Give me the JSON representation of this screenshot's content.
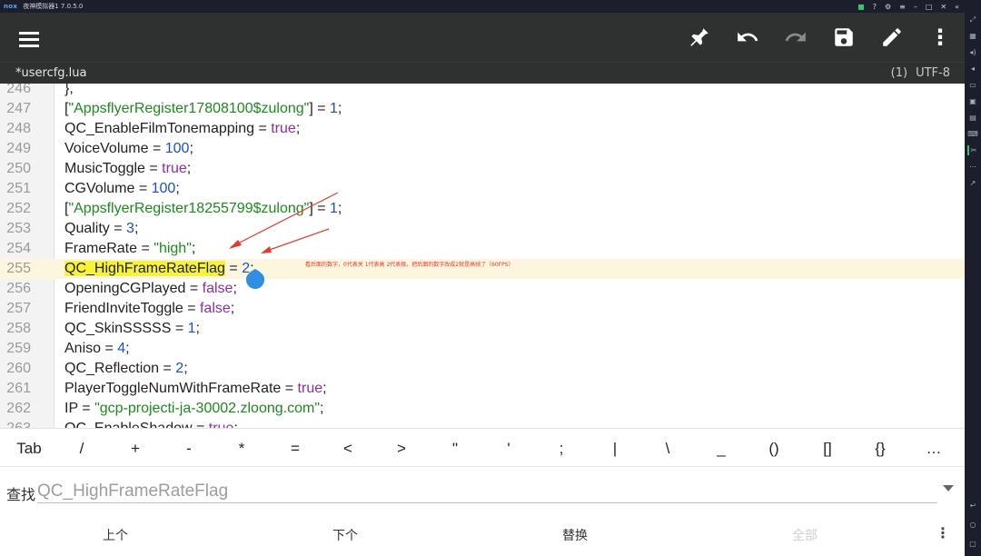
{
  "emulator": {
    "logo": "nox",
    "title": "夜神模拟器1 7.0.5.0"
  },
  "toolbar": {
    "menu": "menu-icon",
    "pin": "pin-icon",
    "undo": "undo-icon",
    "redo": "redo-icon",
    "save": "save-icon",
    "edit": "edit-icon",
    "more": "more-vert-icon"
  },
  "file": {
    "name": "*usercfg.lua",
    "count": "(1)",
    "encoding": "UTF-8"
  },
  "lines": [
    {
      "num": "246",
      "tokens": [
        {
          "t": "},",
          "c": ""
        }
      ]
    },
    {
      "num": "247",
      "tokens": [
        {
          "t": "[",
          "c": ""
        },
        {
          "t": "\"AppsflyerRegister17808100$zulong\"",
          "c": "str"
        },
        {
          "t": "] = ",
          "c": ""
        },
        {
          "t": "1",
          "c": "num"
        },
        {
          "t": ";",
          "c": ""
        }
      ]
    },
    {
      "num": "248",
      "tokens": [
        {
          "t": "QC_EnableFilmTonemapping = ",
          "c": ""
        },
        {
          "t": "true",
          "c": "kw"
        },
        {
          "t": ";",
          "c": ""
        }
      ]
    },
    {
      "num": "249",
      "tokens": [
        {
          "t": "VoiceVolume = ",
          "c": ""
        },
        {
          "t": "100",
          "c": "num"
        },
        {
          "t": ";",
          "c": ""
        }
      ]
    },
    {
      "num": "250",
      "tokens": [
        {
          "t": "MusicToggle = ",
          "c": ""
        },
        {
          "t": "true",
          "c": "kw"
        },
        {
          "t": ";",
          "c": ""
        }
      ]
    },
    {
      "num": "251",
      "tokens": [
        {
          "t": "CGVolume = ",
          "c": ""
        },
        {
          "t": "100",
          "c": "num"
        },
        {
          "t": ";",
          "c": ""
        }
      ]
    },
    {
      "num": "252",
      "tokens": [
        {
          "t": "[",
          "c": ""
        },
        {
          "t": "\"AppsflyerRegister18255799$zulong\"",
          "c": "str"
        },
        {
          "t": "] = ",
          "c": ""
        },
        {
          "t": "1",
          "c": "num"
        },
        {
          "t": ";",
          "c": ""
        }
      ]
    },
    {
      "num": "253",
      "tokens": [
        {
          "t": "Quality = ",
          "c": ""
        },
        {
          "t": "3",
          "c": "num"
        },
        {
          "t": ";",
          "c": ""
        }
      ]
    },
    {
      "num": "254",
      "tokens": [
        {
          "t": "FrameRate = ",
          "c": ""
        },
        {
          "t": "\"high\"",
          "c": "str"
        },
        {
          "t": ";",
          "c": ""
        }
      ]
    },
    {
      "num": "255",
      "highlight": true,
      "tokens": [
        {
          "t": "QC_HighFrameRateFlag",
          "c": "match"
        },
        {
          "t": " = ",
          "c": ""
        },
        {
          "t": "2",
          "c": "num"
        },
        {
          "t": ";",
          "c": ""
        }
      ]
    },
    {
      "num": "256",
      "tokens": [
        {
          "t": "OpeningCGPlayed = ",
          "c": ""
        },
        {
          "t": "false",
          "c": "kw"
        },
        {
          "t": ";",
          "c": ""
        }
      ]
    },
    {
      "num": "257",
      "tokens": [
        {
          "t": "FriendInviteToggle = ",
          "c": ""
        },
        {
          "t": "false",
          "c": "kw"
        },
        {
          "t": ";",
          "c": ""
        }
      ]
    },
    {
      "num": "258",
      "tokens": [
        {
          "t": "QC_SkinSSSSS = ",
          "c": ""
        },
        {
          "t": "1",
          "c": "num"
        },
        {
          "t": ";",
          "c": ""
        }
      ]
    },
    {
      "num": "259",
      "tokens": [
        {
          "t": "Aniso = ",
          "c": ""
        },
        {
          "t": "4",
          "c": "num"
        },
        {
          "t": ";",
          "c": ""
        }
      ]
    },
    {
      "num": "260",
      "tokens": [
        {
          "t": "QC_Reflection = ",
          "c": ""
        },
        {
          "t": "2",
          "c": "num"
        },
        {
          "t": ";",
          "c": ""
        }
      ]
    },
    {
      "num": "261",
      "tokens": [
        {
          "t": "PlayerToggleNumWithFrameRate = ",
          "c": ""
        },
        {
          "t": "true",
          "c": "kw"
        },
        {
          "t": ";",
          "c": ""
        }
      ]
    },
    {
      "num": "262",
      "tokens": [
        {
          "t": "IP = ",
          "c": ""
        },
        {
          "t": "\"gcp-projecti-ja-30002.zloong.com\"",
          "c": "str"
        },
        {
          "t": ";",
          "c": ""
        }
      ]
    },
    {
      "num": "263",
      "tokens": [
        {
          "t": "QC_EnableShadow = ",
          "c": ""
        },
        {
          "t": "true",
          "c": "kw"
        },
        {
          "t": ";",
          "c": ""
        }
      ]
    }
  ],
  "annotation": "看后面的数字，0代表关 1代表高 2代表极，把后面的数字改成2就是高帧了（60FPS）",
  "symbols": [
    "Tab",
    "/",
    "+",
    "-",
    "*",
    "=",
    "<",
    ">",
    "\"",
    "'",
    ";",
    "|",
    "\\",
    "_",
    "()",
    "[]",
    "{}",
    "…"
  ],
  "find": {
    "label": "查找",
    "value": "QC_HighFrameRateFlag"
  },
  "actions": {
    "prev": "上个",
    "next": "下个",
    "replace": "替换",
    "all": "全部"
  }
}
